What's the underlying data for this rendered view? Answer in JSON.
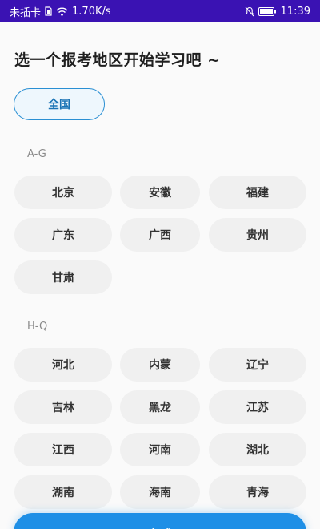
{
  "status_bar": {
    "carrier": "未插卡",
    "speed": "1.70K/s",
    "time": "11:39"
  },
  "title": "选一个报考地区开始学习吧 ~",
  "all_button": "全国",
  "sections": [
    {
      "label": "A-G",
      "items": [
        "北京",
        "安徽",
        "福建",
        "广东",
        "广西",
        "贵州",
        "甘肃"
      ]
    },
    {
      "label": "H-Q",
      "items": [
        "河北",
        "内蒙",
        "辽宁",
        "吉林",
        "黑龙",
        "江苏",
        "江西",
        "河南",
        "湖北",
        "湖南",
        "海南",
        "青海"
      ]
    }
  ],
  "done_button": "完成"
}
